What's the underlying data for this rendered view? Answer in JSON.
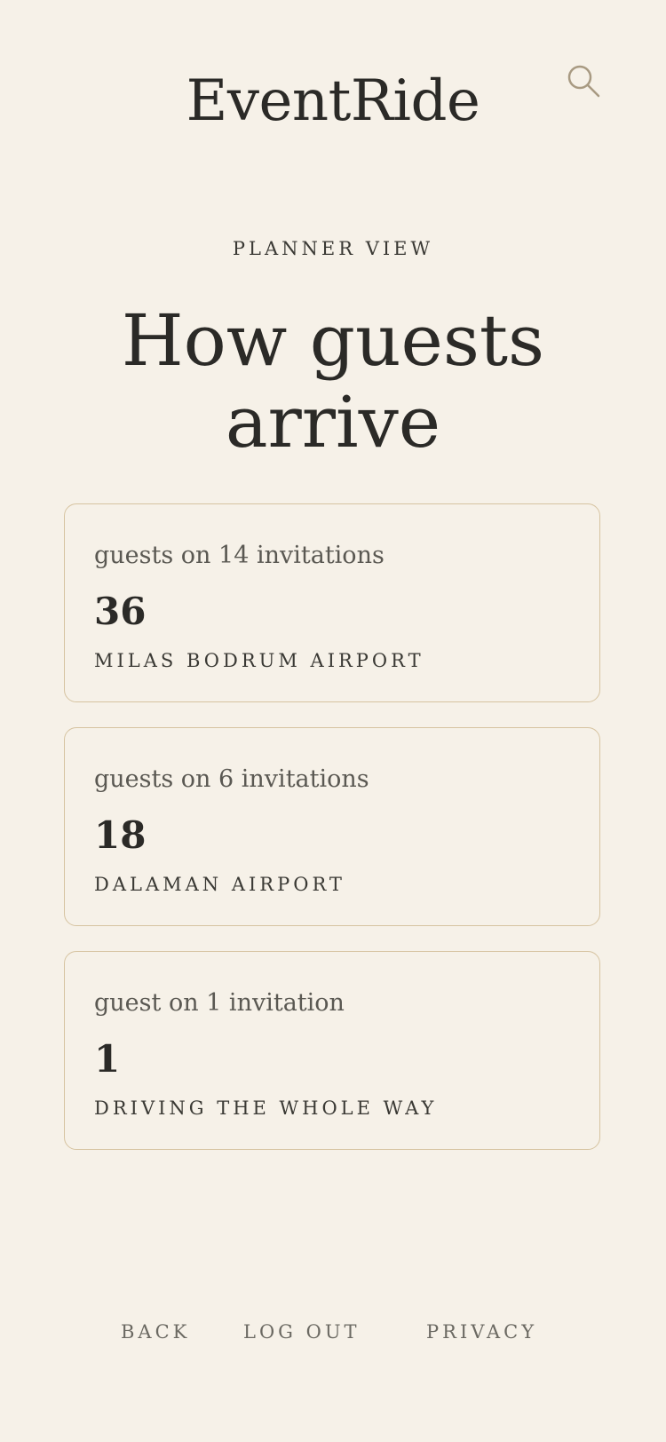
{
  "header": {
    "brand": "EventRide",
    "search_icon": "search-icon"
  },
  "main": {
    "eyebrow": "PLANNER VIEW",
    "headline_line1": "How guests",
    "headline_line2": "arrive",
    "cards": [
      {
        "caption": "guests on 14 invitations",
        "count": "36",
        "destination": "MILAS BODRUM AIRPORT"
      },
      {
        "caption": "guests on 6 invitations",
        "count": "18",
        "destination": "DALAMAN AIRPORT"
      },
      {
        "caption": "guest on 1 invitation",
        "count": "1",
        "destination": "DRIVING THE WHOLE WAY"
      }
    ]
  },
  "footer": {
    "back": "BACK",
    "logout": "LOG OUT",
    "privacy": "PRIVACY"
  },
  "colors": {
    "background": "#f6f1e8",
    "text": "#2b2a27",
    "card_border": "#d6c3a0",
    "muted": "#6b6962"
  }
}
